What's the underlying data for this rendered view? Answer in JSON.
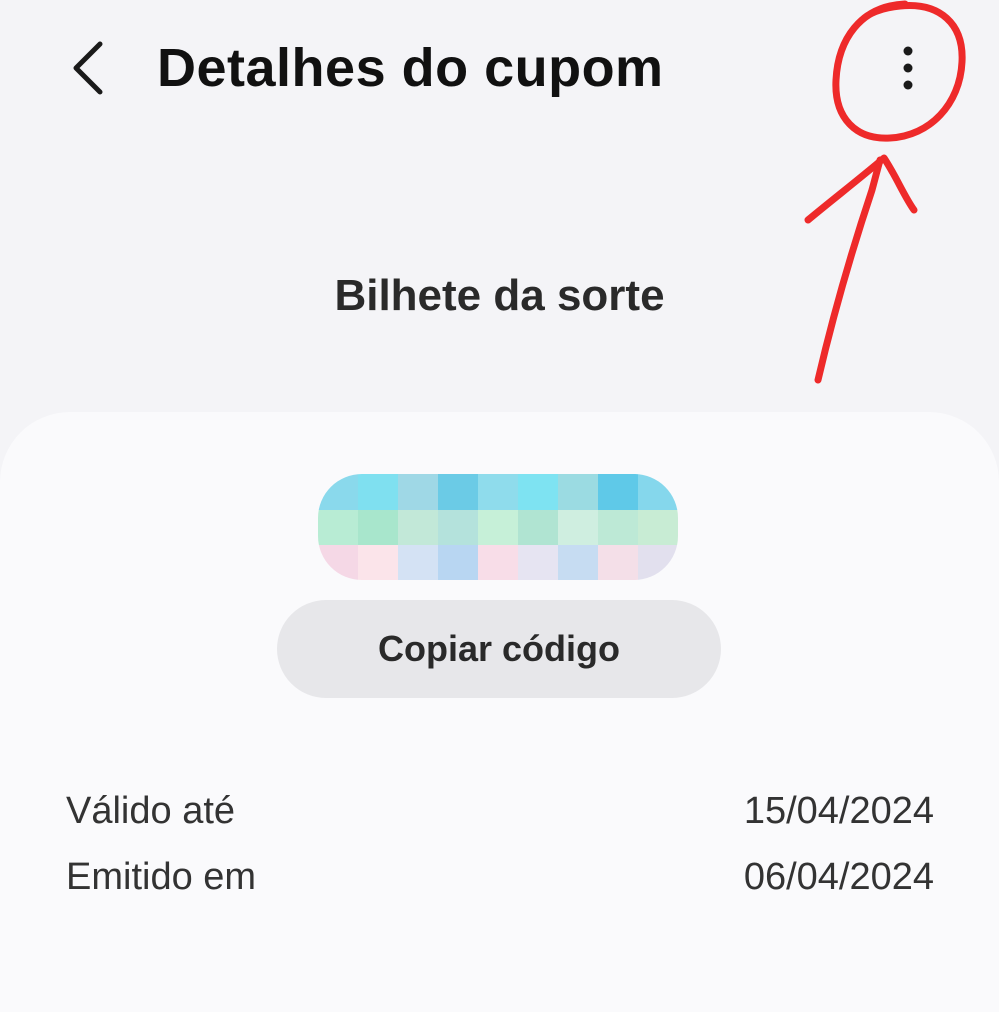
{
  "header": {
    "back_icon": "chevron-left-icon",
    "title": "Detalhes do cupom",
    "more_icon": "more-vertical-icon"
  },
  "coupon": {
    "name": "Bilhete da sorte",
    "copy_button_label": "Copiar código"
  },
  "details": [
    {
      "label": "Válido até",
      "value": "15/04/2024"
    },
    {
      "label": "Emitido em",
      "value": "06/04/2024"
    }
  ],
  "colors": {
    "background": "#f4f4f7",
    "card": "#fafafc",
    "button": "#e7e7ea",
    "annotation_red": "#ee2a2a"
  }
}
